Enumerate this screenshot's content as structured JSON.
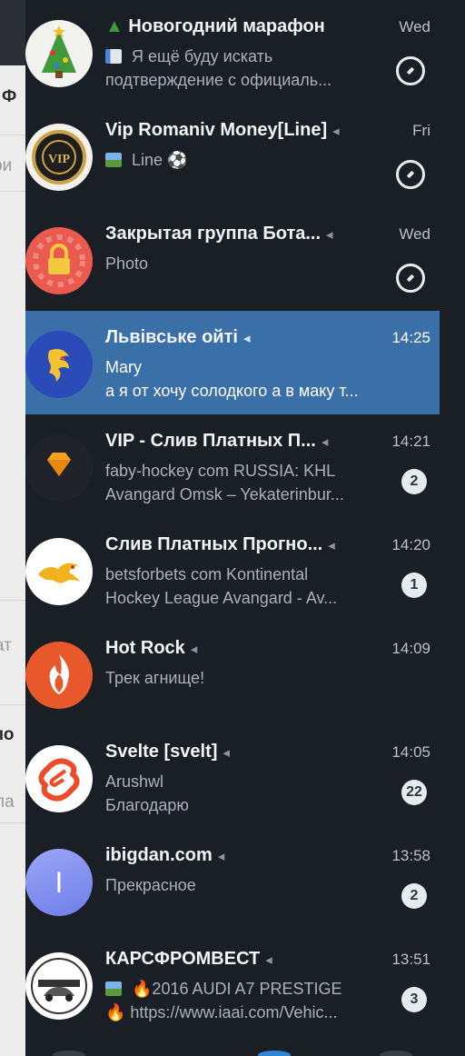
{
  "background_window": {
    "fragments": [
      "Ф",
      "ри",
      "ат",
      "ло",
      "ла"
    ]
  },
  "colors": {
    "panel_bg": "#1a1f26",
    "active_row_bg": "#3a6fa8",
    "badge_bg": "#e6ebf0"
  },
  "chats": [
    {
      "title": "Новогодний марафон",
      "muted": false,
      "time": "Wed",
      "line1": "Я ещё буду искать",
      "line2": "подтверждение с официаль...",
      "line1_icon": "chart-thumbnail-icon",
      "pinned": true,
      "badge": null,
      "avatar": "christmas-tree-avatar"
    },
    {
      "title": "Vip Romaniv Money[Line]",
      "muted": true,
      "time": "Fri",
      "line1": "Line",
      "line2": "",
      "line1_icon": "photo-thumbnail-icon",
      "pinned": true,
      "badge": null,
      "avatar": "vip-coin-avatar"
    },
    {
      "title": "Закрытая группа Бота...",
      "muted": true,
      "time": "Wed",
      "line1": "Photo",
      "line2": "",
      "pinned": true,
      "badge": null,
      "avatar": "lock-avatar"
    },
    {
      "title": "Львівське ойті",
      "muted": true,
      "time": "14:25",
      "line1": "Mary",
      "line2": "а я от хочу солодкого а в маку т...",
      "pinned": false,
      "badge": null,
      "active": true,
      "avatar": "lion-avatar"
    },
    {
      "title": "VIP - Слив Платных П...",
      "muted": true,
      "time": "14:21",
      "line1": "faby-hockey com  RUSSIA: KHL",
      "line2": "Avangard Omsk – Yekaterinbur...",
      "pinned": false,
      "badge": "2",
      "avatar": "diamond-avatar"
    },
    {
      "title": "Слив Платных Прогно...",
      "muted": true,
      "time": "14:20",
      "line1": "betsforbets com  Kontinental",
      "line2": "Hockey League  Avangard - Av...",
      "pinned": false,
      "badge": "1",
      "avatar": "dragon-avatar"
    },
    {
      "title": "Hot Rock",
      "muted": true,
      "time": "14:09",
      "line1": "Трек агнище!",
      "line2": "",
      "pinned": false,
      "badge": null,
      "avatar": "flame-avatar"
    },
    {
      "title": "Svelte [svelt]",
      "muted": true,
      "time": "14:05",
      "line1": "Arushwl",
      "line2": "Благодарю",
      "pinned": false,
      "badge": "22",
      "avatar": "svelte-logo-avatar"
    },
    {
      "title": "ibigdan.com",
      "muted": true,
      "time": "13:58",
      "line1": "Прекрасное",
      "line2": "",
      "pinned": false,
      "badge": "2",
      "avatar": "letter-i-avatar",
      "avatar_letter": "I"
    },
    {
      "title": "КАРСФРОМВЕСТ",
      "muted": true,
      "time": "13:51",
      "line1": "🔥2016 AUDI A7 PRESTIGE",
      "line2": "🔥 https://www.iaai.com/Vehic...",
      "line1_icon": "photo-thumbnail-icon",
      "pinned": false,
      "badge": "3",
      "avatar": "car-avatar"
    }
  ]
}
